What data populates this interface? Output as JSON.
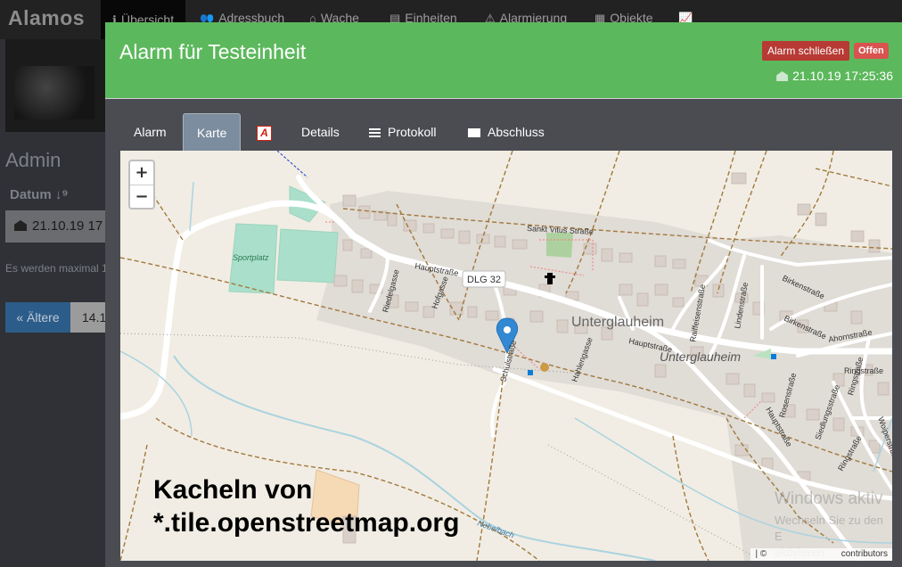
{
  "app": {
    "brand": "Alamos"
  },
  "nav": {
    "items": [
      {
        "label": "Übersicht",
        "icon": "info-icon"
      },
      {
        "label": "Adressbuch",
        "icon": "users-icon"
      },
      {
        "label": "Wache",
        "icon": "home-icon"
      },
      {
        "label": "Einheiten",
        "icon": "folder-icon"
      },
      {
        "label": "Alarmierung",
        "icon": "warning-icon"
      },
      {
        "label": "Objekte",
        "icon": "building-icon"
      },
      {
        "label": "",
        "icon": "chart-line-icon"
      }
    ]
  },
  "background": {
    "heading": "Admin",
    "datum_label": "Datum",
    "row_date": "21.10.19 17",
    "note": "Es werden maximal 1",
    "older_button": "« Ältere",
    "row2_date": "14.1"
  },
  "modal": {
    "title": "Alarm für Testeinheit",
    "close_button": "Alarm schließen",
    "status_badge": "Offen",
    "timestamp": "21.10.19 17:25:36",
    "header_color": "#5cb85c",
    "tabs": [
      {
        "label": "Alarm"
      },
      {
        "label": "Karte",
        "active": true
      },
      {
        "label": ""
      },
      {
        "label": "Details"
      },
      {
        "label": "Protokoll"
      },
      {
        "label": "Abschluss"
      }
    ],
    "pdf_icon_glyph": "A"
  },
  "map": {
    "zoom_in": "+",
    "zoom_out": "−",
    "labels": {
      "sankt_vitus": "Sankt Vitus Straße",
      "hauptstrasse": "Hauptstraße",
      "road_ref": "DLG 32",
      "riedelgasse": "Riedelgasse",
      "hofgasse": "Hofgasse",
      "unterglauheim": "Unterglauheim",
      "hauptstrasse_2": "Hauptstraße",
      "raiffeisen": "Raiffeisenstraße",
      "linden": "Lindenstraße",
      "birken": "Birkenstraße",
      "birken_2": "Birkenstraße",
      "ahorn": "Ahornstraße",
      "ring": "Ringstraße",
      "ring_2": "Ringstraße",
      "ring_3": "Ringstraße",
      "rosen": "Rosenstraße",
      "siedlung": "Siedlungsstraße",
      "hauptstrasse_3": "Hauptstraße",
      "woiper": "Woiperstraße",
      "hahlengasse": "Hahlengasse",
      "schulstrasse": "Schulstraße",
      "sportplatz": "Sportplatz",
      "nebelbach": "Nebelbach"
    },
    "tile_caption_line1": "Kacheln von",
    "tile_caption_line2": "*.tile.openstreetmap.org",
    "attribution_left": "| ©",
    "attribution_right": "contributors",
    "watermark_title": "Windows aktiv",
    "watermark_line1": "Wechseln Sie zu den E",
    "watermark_line2": "aktivieren."
  }
}
